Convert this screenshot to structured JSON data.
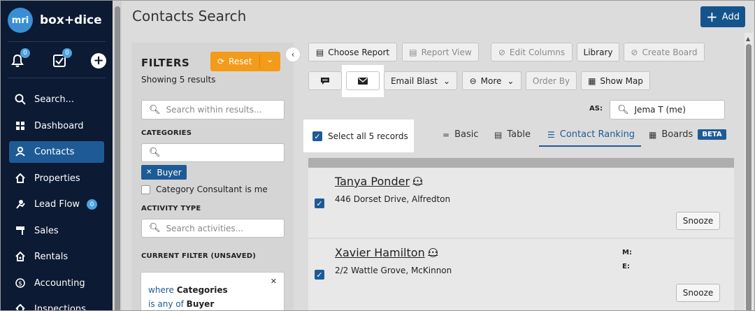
{
  "brand": {
    "logo": "mri",
    "name": "box+dice"
  },
  "quick_actions": {
    "notifications_count": "0",
    "tasks_count": "0"
  },
  "nav": {
    "items": [
      {
        "label": "Search...",
        "icon": "search-icon"
      },
      {
        "label": "Dashboard",
        "icon": "dashboard-icon"
      },
      {
        "label": "Contacts",
        "icon": "contacts-icon",
        "active": true
      },
      {
        "label": "Properties",
        "icon": "home-icon"
      },
      {
        "label": "Lead Flow",
        "icon": "lead-flow-icon",
        "badge": "0"
      },
      {
        "label": "Sales",
        "icon": "sales-icon"
      },
      {
        "label": "Rentals",
        "icon": "rentals-icon"
      },
      {
        "label": "Accounting",
        "icon": "dollar-icon"
      },
      {
        "label": "Inspections",
        "icon": "inspections-icon"
      }
    ]
  },
  "header": {
    "title": "Contacts Search",
    "add_label": "Add"
  },
  "filters": {
    "title": "FILTERS",
    "reset_label": "Reset",
    "showing": "Showing 5 results",
    "search_placeholder": "Search within results...",
    "categories_label": "CATEGORIES",
    "category_chip": "Buyer",
    "consultant_checkbox": "Category Consultant is me",
    "activity_label": "ACTIVITY TYPE",
    "activity_placeholder": "Search activities...",
    "current_filter_label": "CURRENT FILTER (UNSAVED)",
    "card": {
      "where": "where",
      "field": "Categories",
      "op": "is any of",
      "value": "Buyer"
    }
  },
  "toolbar": {
    "choose_report": "Choose Report",
    "report_view": "Report View",
    "edit_columns": "Edit Columns",
    "library": "Library",
    "create_board": "Create Board",
    "email_blast": "Email Blast",
    "more": "More",
    "order_by": "Order By",
    "show_map": "Show Map",
    "as_label": "AS:",
    "as_value": "Jema T (me)"
  },
  "select_all": "Select all 5 records",
  "views": {
    "basic": "Basic",
    "table": "Table",
    "ranking": "Contact Ranking",
    "boards": "Boards",
    "beta": "BETA"
  },
  "contacts": [
    {
      "name": "Tanya Ponder",
      "address": "446 Dorset Drive, Alfredton",
      "snooze": "Snooze"
    },
    {
      "name": "Xavier Hamilton",
      "address": "2/2 Wattle Grove, McKinnon",
      "m_label": "M:",
      "e_label": "E:",
      "snooze": "Snooze"
    }
  ],
  "colors": {
    "sidebar_bg": "#0c1a33",
    "accent": "#1e5b96",
    "reset": "#f39b1a"
  }
}
